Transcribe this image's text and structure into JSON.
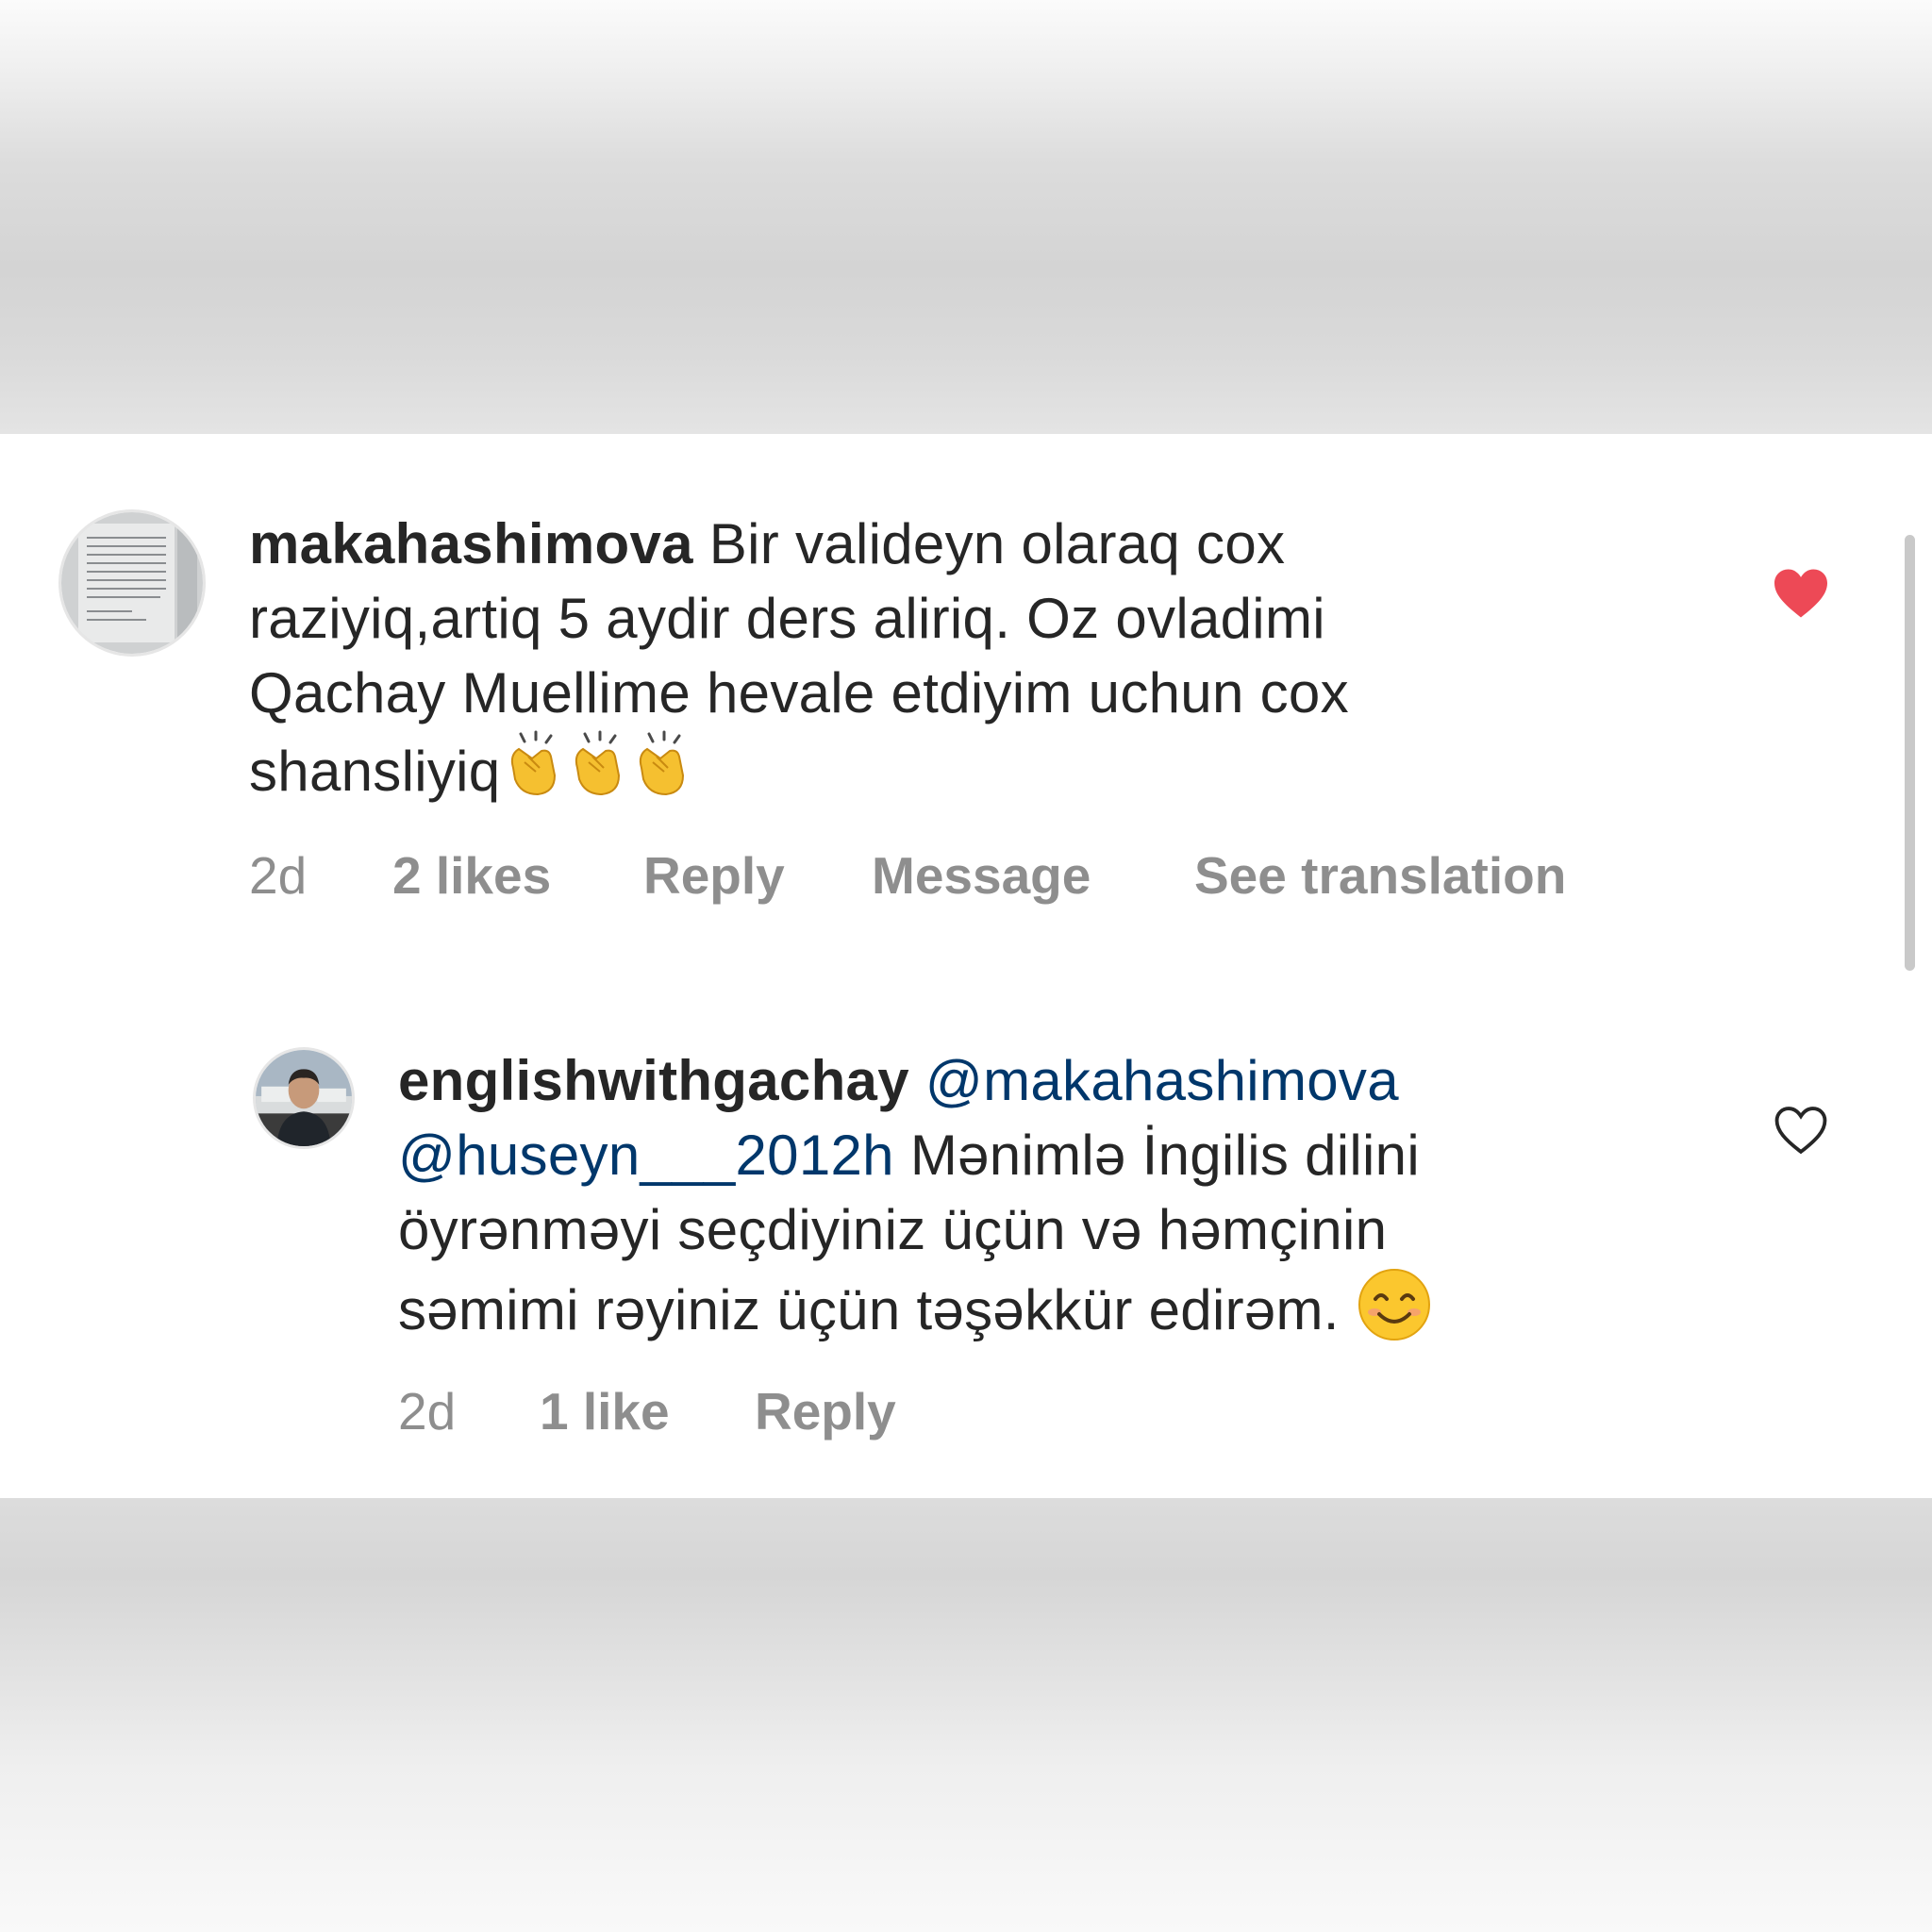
{
  "comments": [
    {
      "username": "makahashimova",
      "lines": [
        "Bir  valideyn olaraq  cox",
        "raziyiq,artiq 5 aydir ders aliriq. Oz ovladimi",
        "Qachay Muellime hevale etdiyim uchun cox",
        "shansliyiq"
      ],
      "emojis": [
        "clapping-hands",
        "clapping-hands",
        "clapping-hands"
      ],
      "time": "2d",
      "likes": "2 likes",
      "reply_label": "Reply",
      "message_label": "Message",
      "translation_label": "See translation",
      "liked": true,
      "heart_color": "#ed4956"
    },
    {
      "username": "englishwithgachay",
      "mention1": "@makahashimova",
      "mention2": "@huseyn___2012h",
      "line2_rest": "Mənimlə İngilis dilini",
      "line3": "öyrənməyi seçdiyiniz üçün və həmçinin",
      "line4": "səmimi rəyiniz üçün təşəkkür edirəm.",
      "emoji": "smiling-face",
      "time": "2d",
      "likes": "1 like",
      "reply_label": "Reply",
      "liked": false
    }
  ],
  "colors": {
    "text": "#262626",
    "meta": "#8e8e8e",
    "mention": "#00376b",
    "like_red": "#ed4956"
  }
}
